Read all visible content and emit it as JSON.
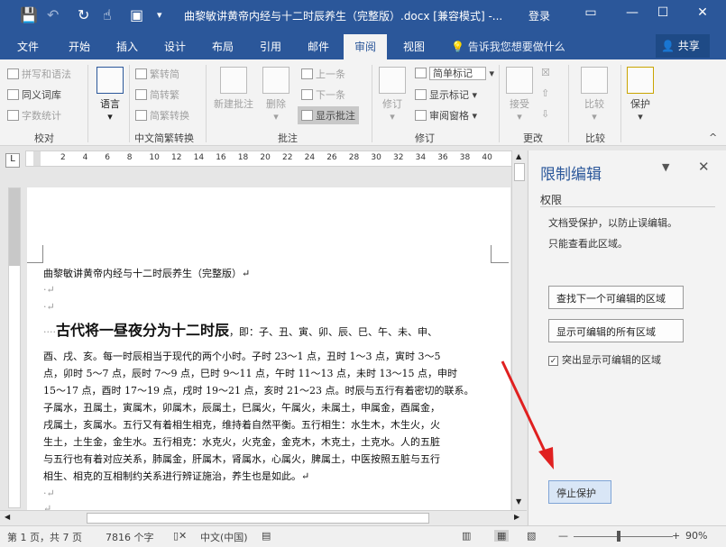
{
  "titlebar": {
    "doc_title": "曲黎敏讲黄帝内经与十二时辰养生（完整版）.docx [兼容模式] -...",
    "login": "登录",
    "save_icon": "save-icon",
    "undo_icon": "undo-icon",
    "redo_icon": "redo-icon",
    "touch_icon": "touch-icon",
    "window_icon": "window-icon",
    "customize_icon": "customize-icon",
    "minimize": "—",
    "maximize": "☐",
    "close": "✕",
    "restore": "▭"
  },
  "menu": {
    "tabs": [
      "文件",
      "开始",
      "插入",
      "设计",
      "布局",
      "引用",
      "邮件",
      "审阅",
      "视图"
    ],
    "active": "审阅",
    "tell_me": "告诉我您想要做什么",
    "share": "共享"
  },
  "ribbon": {
    "proofing": {
      "spelling": "拼写和语法",
      "thesaurus": "同义词库",
      "word_count": "字数统计",
      "group": "校对"
    },
    "language": {
      "label": "语言"
    },
    "chinese_conv": {
      "to_trad": "繁转简",
      "to_simp": "简转繁",
      "convert": "简繁转换",
      "group": "中文简繁转换"
    },
    "comments": {
      "new": "新建批注",
      "delete": "删除",
      "prev": "上一条",
      "next": "下一条",
      "show": "显示批注",
      "group": "批注"
    },
    "tracking": {
      "track": "修订",
      "markup": "简单标记",
      "show_markup": "显示标记",
      "pane": "审阅窗格",
      "group": "修订"
    },
    "changes": {
      "accept": "接受",
      "group": "更改"
    },
    "compare": {
      "label": "比较",
      "group": "比较"
    },
    "protect": {
      "label": "保护"
    }
  },
  "ruler": {
    "numbers": [
      "2",
      "4",
      "6",
      "8",
      "10",
      "12",
      "14",
      "16",
      "18",
      "20",
      "22",
      "24",
      "26",
      "28",
      "30",
      "32",
      "34",
      "36",
      "38",
      "40"
    ],
    "tab_selector": "L"
  },
  "document": {
    "title_line": "曲黎敏讲黄帝内经与十二时辰养生（完整版）↵",
    "empty1": "·↵",
    "empty2": "·↵",
    "heading_prefix": "····",
    "heading": "古代将一昼夜分为十二时辰",
    "heading_tail": "，即：子、丑、寅、卯、辰、巳、午、未、申、",
    "lines": [
      "酉、戌、亥。每一时辰相当于现代的两个小时。子时 23～1 点，丑时 1～3 点，寅时 3～5",
      "点，卯时 5～7 点，辰时 7～9 点，巳时 9～11 点，午时 11～13 点，未时 13～15 点，申时",
      "15～17 点，酉时 17～19 点，戌时 19～21 点，亥时 21～23 点。时辰与五行有着密切的联系。",
      "子属水，丑属土，寅属木，卯属木，辰属土，巳属火，午属火，未属土，申属金，酉属金，",
      "戌属土，亥属水。五行又有着相生相克，维持着自然平衡。五行相生：水生木，木生火，火",
      "生土，土生金，金生水。五行相克：水克火，火克金，金克木，木克土，土克水。人的五脏",
      "与五行也有着对应关系，肺属金，肝属木，肾属水，心属火，脾属土，中医按照五脏与五行",
      "相生、相克的互相制约关系进行辨证施治，养生也是如此。↵"
    ],
    "empty3": "·↵",
    "empty4": "↵"
  },
  "pane": {
    "title": "限制编辑",
    "section": "权限",
    "desc1": "文档受保护，以防止误编辑。",
    "desc2": "只能查看此区域。",
    "find_next": "查找下一个可编辑的区域",
    "show_all": "显示可编辑的所有区域",
    "highlight": "突出显示可编辑的区域",
    "stop": "停止保护"
  },
  "status": {
    "page": "第 1 页，共 7 页",
    "words": "7816 个字",
    "lang": "中文(中国)",
    "zoom": "90%",
    "zoom_level": 0.9,
    "minus": "—",
    "plus": "+"
  },
  "colors": {
    "accent": "#2b579a",
    "arrow": "#e02020"
  }
}
